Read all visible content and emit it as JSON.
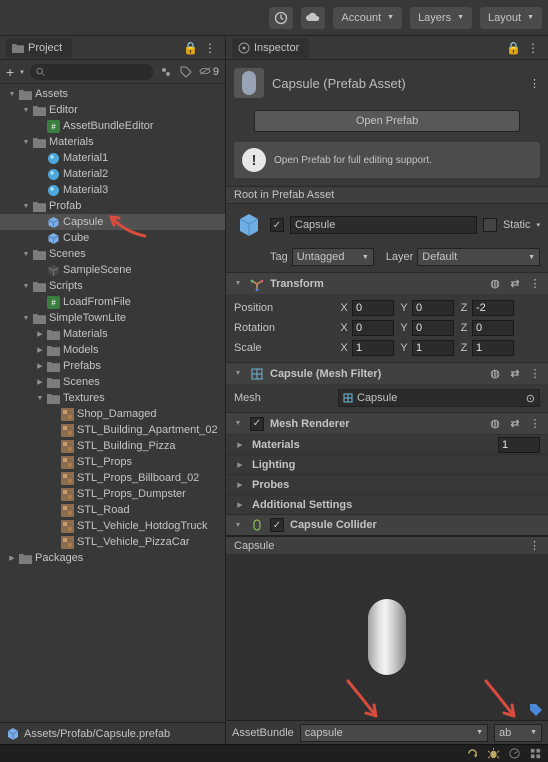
{
  "topbar": {
    "account_label": "Account",
    "layers_label": "Layers",
    "layout_label": "Layout"
  },
  "project": {
    "tab": "Project",
    "hidden_count": "9",
    "search_placeholder": "",
    "path": "Assets/Profab/Capsule.prefab",
    "tree": [
      {
        "d": 0,
        "exp": true,
        "ico": "folder",
        "lbl": "Assets",
        "sel": false
      },
      {
        "d": 1,
        "exp": true,
        "ico": "folder",
        "lbl": "Editor"
      },
      {
        "d": 2,
        "exp": null,
        "ico": "cs",
        "lbl": "AssetBundleEditor"
      },
      {
        "d": 1,
        "exp": true,
        "ico": "folder",
        "lbl": "Materials"
      },
      {
        "d": 2,
        "exp": null,
        "ico": "mat",
        "lbl": "Material1"
      },
      {
        "d": 2,
        "exp": null,
        "ico": "mat",
        "lbl": "Material2"
      },
      {
        "d": 2,
        "exp": null,
        "ico": "mat",
        "lbl": "Material3"
      },
      {
        "d": 1,
        "exp": true,
        "ico": "folder",
        "lbl": "Profab"
      },
      {
        "d": 2,
        "exp": null,
        "ico": "prefab",
        "lbl": "Capsule",
        "sel": true
      },
      {
        "d": 2,
        "exp": null,
        "ico": "prefab",
        "lbl": "Cube"
      },
      {
        "d": 1,
        "exp": true,
        "ico": "folder",
        "lbl": "Scenes"
      },
      {
        "d": 2,
        "exp": null,
        "ico": "scene",
        "lbl": "SampleScene"
      },
      {
        "d": 1,
        "exp": true,
        "ico": "folder",
        "lbl": "Scripts"
      },
      {
        "d": 2,
        "exp": null,
        "ico": "cs",
        "lbl": "LoadFromFile"
      },
      {
        "d": 1,
        "exp": true,
        "ico": "folder",
        "lbl": "SimpleTownLite"
      },
      {
        "d": 2,
        "exp": false,
        "ico": "folder",
        "lbl": "Materials"
      },
      {
        "d": 2,
        "exp": false,
        "ico": "folder",
        "lbl": "Models"
      },
      {
        "d": 2,
        "exp": false,
        "ico": "folder",
        "lbl": "Prefabs"
      },
      {
        "d": 2,
        "exp": false,
        "ico": "folder",
        "lbl": "Scenes"
      },
      {
        "d": 2,
        "exp": true,
        "ico": "folder",
        "lbl": "Textures"
      },
      {
        "d": 3,
        "exp": null,
        "ico": "tex",
        "lbl": "Shop_Damaged"
      },
      {
        "d": 3,
        "exp": null,
        "ico": "tex",
        "lbl": "STL_Building_Apartment_02"
      },
      {
        "d": 3,
        "exp": null,
        "ico": "tex",
        "lbl": "STL_Building_Pizza"
      },
      {
        "d": 3,
        "exp": null,
        "ico": "tex",
        "lbl": "STL_Props"
      },
      {
        "d": 3,
        "exp": null,
        "ico": "tex",
        "lbl": "STL_Props_Billboard_02"
      },
      {
        "d": 3,
        "exp": null,
        "ico": "tex",
        "lbl": "STL_Props_Dumpster"
      },
      {
        "d": 3,
        "exp": null,
        "ico": "tex",
        "lbl": "STL_Road"
      },
      {
        "d": 3,
        "exp": null,
        "ico": "tex",
        "lbl": "STL_Vehicle_HotdogTruck"
      },
      {
        "d": 3,
        "exp": null,
        "ico": "tex",
        "lbl": "STL_Vehicle_PizzaCar"
      },
      {
        "d": 0,
        "exp": false,
        "ico": "folder",
        "lbl": "Packages"
      }
    ]
  },
  "inspector": {
    "tab": "Inspector",
    "asset_title": "Capsule (Prefab Asset)",
    "open_prefab": "Open Prefab",
    "open_prefab_msg": "Open Prefab for full editing support.",
    "root_label": "Root in Prefab Asset",
    "name": "Capsule",
    "static_label": "Static",
    "tag_label": "Tag",
    "tag_value": "Untagged",
    "layer_label": "Layer",
    "layer_value": "Default",
    "transform": {
      "title": "Transform",
      "rows": [
        {
          "lbl": "Position",
          "x": "0",
          "y": "0",
          "z": "-2"
        },
        {
          "lbl": "Rotation",
          "x": "0",
          "y": "0",
          "z": "0"
        },
        {
          "lbl": "Scale",
          "x": "1",
          "y": "1",
          "z": "1"
        }
      ]
    },
    "meshfilter": {
      "title": "Capsule (Mesh Filter)",
      "mesh_label": "Mesh",
      "mesh_value": "Capsule"
    },
    "meshrenderer": {
      "title": "Mesh Renderer",
      "materials": "Materials",
      "materials_count": "1",
      "lighting": "Lighting",
      "probes": "Probes",
      "additional": "Additional Settings"
    },
    "collider": {
      "title": "Capsule Collider"
    },
    "preview_title": "Capsule",
    "assetbundle_label": "AssetBundle",
    "assetbundle_value": "capsule",
    "assetbundle_variant": "ab"
  }
}
